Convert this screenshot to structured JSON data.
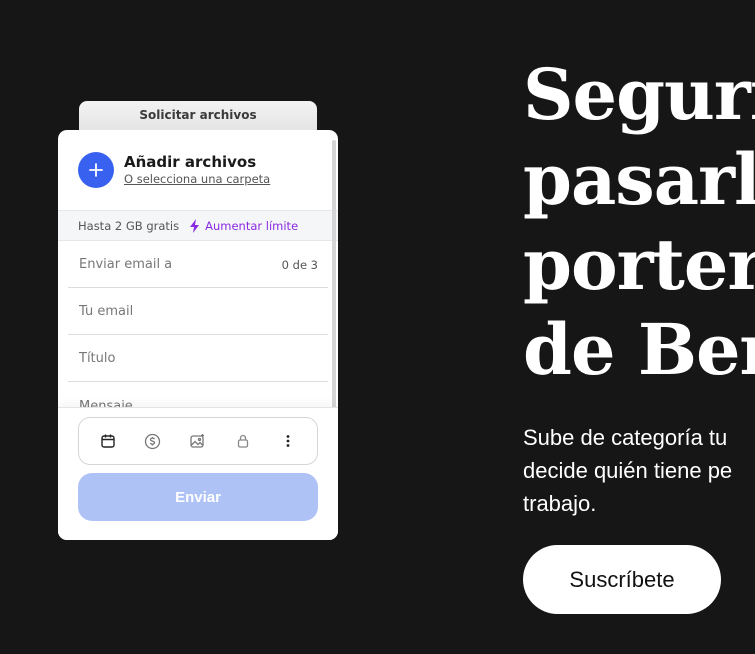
{
  "widget": {
    "tab_label": "Solicitar archivos",
    "add_title": "Añadir archivos",
    "add_subtitle": "O selecciona una carpeta",
    "limit_text": "Hasta 2 GB gratis",
    "boost_label": "Aumentar límite",
    "fields": [
      {
        "label": "Enviar email a",
        "count": "0 de 3"
      },
      {
        "label": "Tu email"
      },
      {
        "label": "Título"
      },
      {
        "label": "Mensaje"
      }
    ],
    "options_icons": [
      "calendar-icon",
      "dollar-icon",
      "image-icon",
      "lock-icon",
      "more-vertical-icon"
    ],
    "send_label": "Enviar",
    "colors": {
      "accent": "#3861f0",
      "send_disabled": "#aec2f6",
      "boost": "#8a2be2"
    }
  },
  "hero": {
    "title_lines": [
      "Segurid",
      "pasarlo",
      "portero",
      "de Berl"
    ],
    "subtitle_lines": [
      "Sube de categoría tu",
      "decide quién tiene pe",
      "trabajo."
    ],
    "cta_label": "Suscríbete"
  },
  "page": {
    "background": "#161616"
  }
}
